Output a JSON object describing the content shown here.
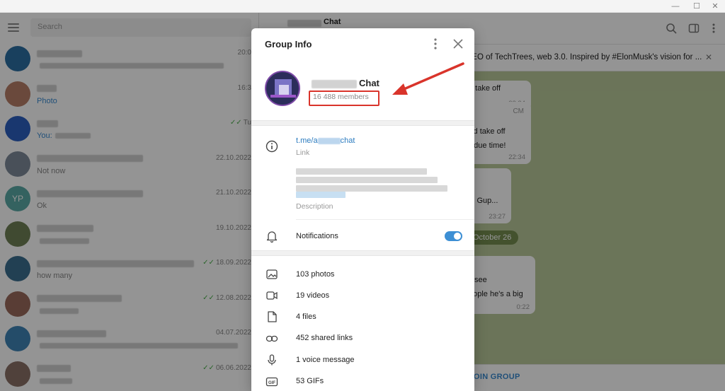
{
  "sidebar": {
    "search_placeholder": "Search",
    "chats": [
      {
        "date": "20:0",
        "msg": "",
        "color": "#2b6fa3"
      },
      {
        "date": "16:3",
        "msg": "Photo",
        "color": "#b77f68"
      },
      {
        "date": "Tu",
        "msg": "You:",
        "color": "#2c5fc0"
      },
      {
        "date": "22.10.2022",
        "msg": "Not now",
        "color": "#7e8b9a"
      },
      {
        "date": "21.10.2022",
        "msg": "Ok",
        "initials": "YP",
        "color": "#5aa9a6"
      },
      {
        "date": "19.10.2022",
        "msg": "",
        "color": "#6f8055"
      },
      {
        "date": "18.09.2022",
        "msg": "how many",
        "color": "#3b6e8f"
      },
      {
        "date": "12.08.2022",
        "msg": "",
        "color": "#9a6a5c"
      },
      {
        "date": "04.07.2022",
        "msg": "",
        "color": "#3f84b5"
      },
      {
        "date": "06.06.2022",
        "msg": "",
        "color": "#8a7066"
      }
    ]
  },
  "chat": {
    "title": "Chat",
    "pinned": "CEO of TechTrees, web 3.0. Inspired by #ElonMusk's vision for ...",
    "bubbles": [
      {
        "text": "d take off",
        "time": "22:34"
      },
      {
        "text1": "uld take off",
        "text2": "n due time!",
        "sender": "CM",
        "time": "22:34"
      },
      {
        "text": "S. Gup...",
        "extra": "e",
        "time": "23:27"
      },
      {
        "text1": "see",
        "text2": "eople he's a big",
        "time": "0:22"
      }
    ],
    "date_pill": "October 26",
    "join": "OIN GROUP"
  },
  "modal": {
    "title": "Group Info",
    "group_name": "Chat",
    "members": "16 488 members",
    "link": "t.me/a",
    "link_suffix": "chat",
    "link_label": "Link",
    "description_label": "Description",
    "notifications_label": "Notifications",
    "notifications_on": true,
    "media": [
      {
        "icon": "photo-icon",
        "label": "103 photos"
      },
      {
        "icon": "video-icon",
        "label": "19 videos"
      },
      {
        "icon": "file-icon",
        "label": "4 files"
      },
      {
        "icon": "link-icon",
        "label": "452 shared links"
      },
      {
        "icon": "microphone-icon",
        "label": "1 voice message"
      },
      {
        "icon": "gif-icon",
        "label": "53 GIFs"
      }
    ]
  },
  "colors": {
    "accent": "#3d8fd4",
    "highlight": "#d9342b",
    "chat_bg": "#b9c99a"
  }
}
